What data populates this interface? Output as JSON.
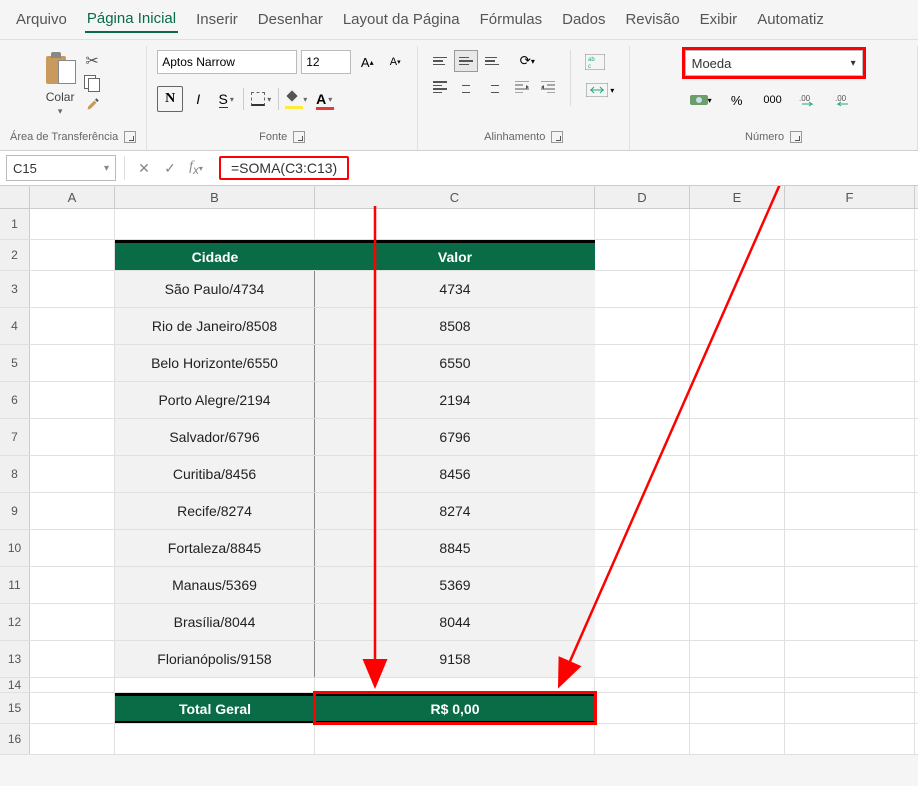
{
  "menu": {
    "items": [
      "Arquivo",
      "Página Inicial",
      "Inserir",
      "Desenhar",
      "Layout da Página",
      "Fórmulas",
      "Dados",
      "Revisão",
      "Exibir",
      "Automatiz"
    ],
    "active_index": 1
  },
  "ribbon": {
    "clipboard": {
      "label": "Área de Transferência",
      "paste": "Colar"
    },
    "font": {
      "label": "Fonte",
      "name": "Aptos Narrow",
      "size": "12"
    },
    "alignment": {
      "label": "Alinhamento"
    },
    "number": {
      "label": "Número",
      "format": "Moeda"
    }
  },
  "formula_bar": {
    "name_box": "C15",
    "formula": "=SOMA(C3:C13)"
  },
  "sheet": {
    "columns": [
      "A",
      "B",
      "C",
      "D",
      "E",
      "F"
    ],
    "headers": {
      "cidade": "Cidade",
      "valor": "Valor"
    },
    "rows": [
      {
        "cidade": "São Paulo/4734",
        "valor": "4734"
      },
      {
        "cidade": "Rio de Janeiro/8508",
        "valor": "8508"
      },
      {
        "cidade": "Belo Horizonte/6550",
        "valor": "6550"
      },
      {
        "cidade": "Porto Alegre/2194",
        "valor": "2194"
      },
      {
        "cidade": "Salvador/6796",
        "valor": "6796"
      },
      {
        "cidade": "Curitiba/8456",
        "valor": "8456"
      },
      {
        "cidade": "Recife/8274",
        "valor": "8274"
      },
      {
        "cidade": "Fortaleza/8845",
        "valor": "8845"
      },
      {
        "cidade": "Manaus/5369",
        "valor": "5369"
      },
      {
        "cidade": "Brasília/8044",
        "valor": "8044"
      },
      {
        "cidade": "Florianópolis/9158",
        "valor": "9158"
      }
    ],
    "total": {
      "label": "Total Geral",
      "value": "R$ 0,00"
    }
  },
  "colors": {
    "brand_green": "#0a6b47",
    "highlight_red": "#f00"
  }
}
